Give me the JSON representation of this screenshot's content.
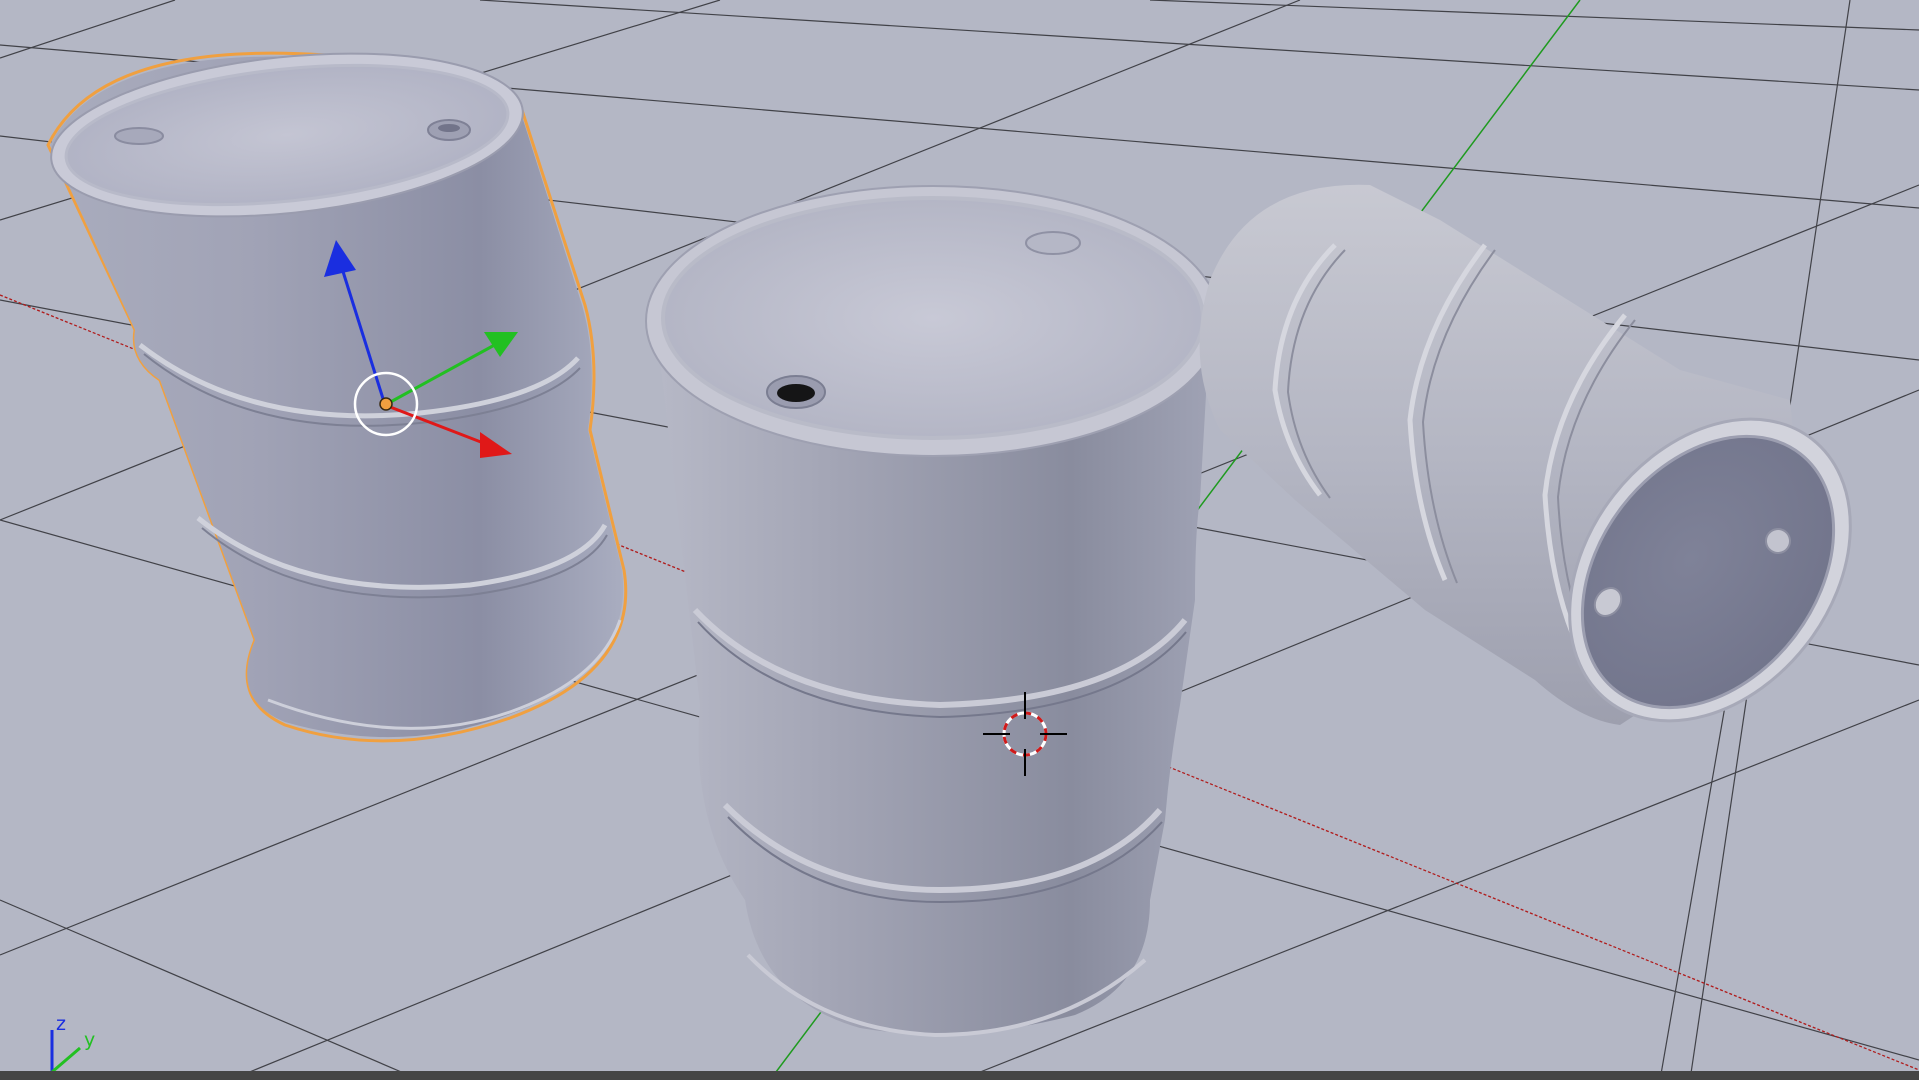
{
  "viewport": {
    "mode": "3D View",
    "background_color": "#b4b7c5",
    "grid_color": "#2e2e33",
    "x_axis_color": "#b01b1b",
    "y_axis_color": "#1f9a1f",
    "selection_outline_color": "#f0a040"
  },
  "objects": [
    {
      "name": "barrel-left",
      "selected": true,
      "orientation": "upright-tilted"
    },
    {
      "name": "barrel-center",
      "selected": false,
      "orientation": "upright"
    },
    {
      "name": "barrel-right",
      "selected": false,
      "orientation": "lying-on-side"
    }
  ],
  "gizmo": {
    "type": "translate-manipulator",
    "x_color": "#e01818",
    "y_color": "#22c022",
    "z_color": "#1a2ee0"
  },
  "cursor_3d": {
    "icon": "3d-cursor-icon"
  },
  "axis_indicator": {
    "z_label": "z",
    "y_label": "y",
    "z_color": "#1a2ee0",
    "y_color": "#22c022",
    "x_color": "#e01818"
  }
}
